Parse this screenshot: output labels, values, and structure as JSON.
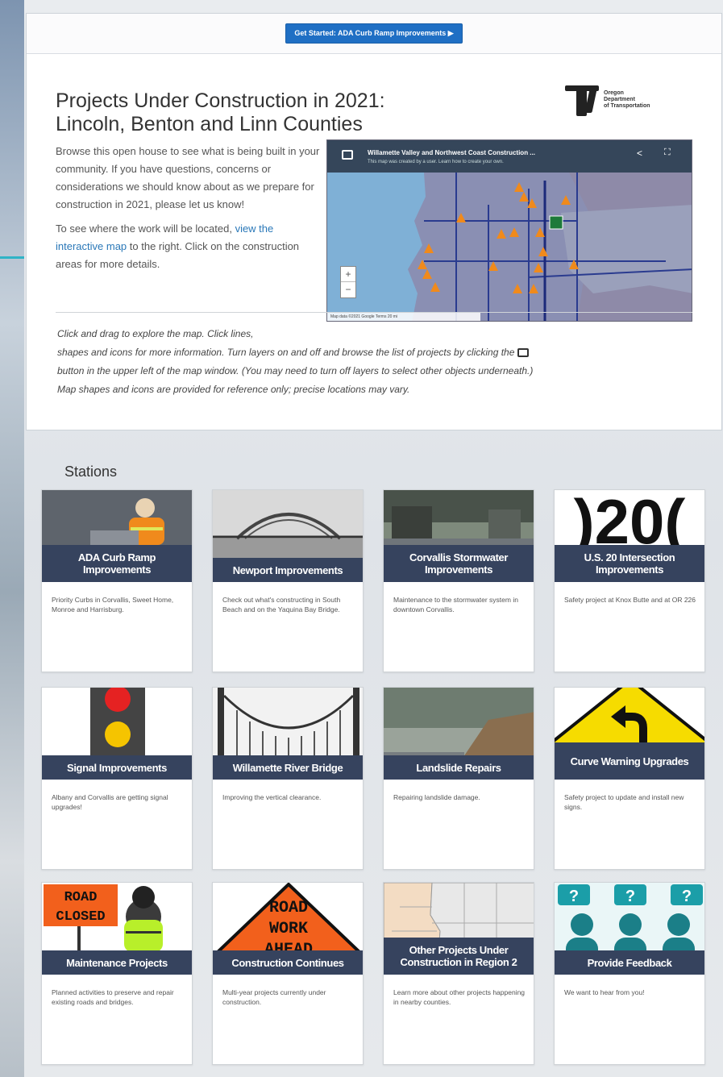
{
  "banner": {
    "button_label": "Get Started: ADA Curb Ramp Improvements ▶"
  },
  "header": {
    "title_line1": "Projects Under Construction in 2021:",
    "title_line2": "Lincoln, Benton and Linn Counties",
    "logo_text_1": "Oregon",
    "logo_text_2": "Department",
    "logo_text_3": "of Transportation"
  },
  "intro": {
    "para1": "Browse this open house to see what is being built in your community. If you have questions, concerns or considerations we should know about as we prepare for construction in 2021, please let us know!",
    "para2_before": "To see where the work will be located, ",
    "para2_link": "view the interactive map",
    "para2_after": " to the right. Click on the construction areas for more details."
  },
  "map": {
    "title": "Willamette Valley and Northwest Coast Construction ...",
    "subtitle": "This map was created by a user. Learn how to create your own.",
    "zoom_in": "+",
    "zoom_out": "−",
    "attribution": "Map data ©2021 Google  Terms  20 mi"
  },
  "instructions": {
    "line1": "Click and drag to explore the map. Click lines,",
    "line2_before": "shapes and icons for more information. Turn layers on and off and browse the list of projects by clicking the ",
    "line3": "button in the upper left of the map window. (You may need to turn off layers to select other objects underneath.)",
    "line4": "Map shapes and icons are provided for reference only; precise locations may vary."
  },
  "stations": {
    "title": "Stations",
    "cards": [
      {
        "label": "ADA Curb Ramp Improvements",
        "desc": "Priority Curbs in Corvallis, Sweet Home, Monroe and Harrisburg."
      },
      {
        "label": "Newport Improvements",
        "desc": "Check out what's constructing in South Beach and on the Yaquina Bay Bridge."
      },
      {
        "label": "Corvallis Stormwater Improvements",
        "desc": "Maintenance to the stormwater system in downtown Corvallis."
      },
      {
        "label": "U.S. 20 Intersection Improvements",
        "desc": "Safety project at Knox Butte and at OR 226",
        "img_text": ")20("
      },
      {
        "label": "Signal Improvements",
        "desc": "Albany and Corvallis are getting signal upgrades!"
      },
      {
        "label": "Willamette River Bridge",
        "desc": "Improving the vertical clearance."
      },
      {
        "label": "Landslide Repairs",
        "desc": "Repairing landslide damage."
      },
      {
        "label": "Curve Warning Upgrades",
        "desc": "Safety project to update and install new signs."
      },
      {
        "label": "Maintenance Projects",
        "desc": "Planned activities to preserve and repair existing roads and bridges.",
        "img_text_1": "ROAD",
        "img_text_2": "CLOSED"
      },
      {
        "label": "Construction Continues",
        "desc": "Multi-year projects currently under construction.",
        "img_text_1": "ROAD",
        "img_text_2": "WORK",
        "img_text_3": "AHEAD"
      },
      {
        "label": "Other Projects Under Construction in Region 2",
        "desc": "Learn more about other projects happening in nearby counties."
      },
      {
        "label": "Provide Feedback",
        "desc": "We want to hear from you!",
        "img_text": "?"
      }
    ]
  }
}
